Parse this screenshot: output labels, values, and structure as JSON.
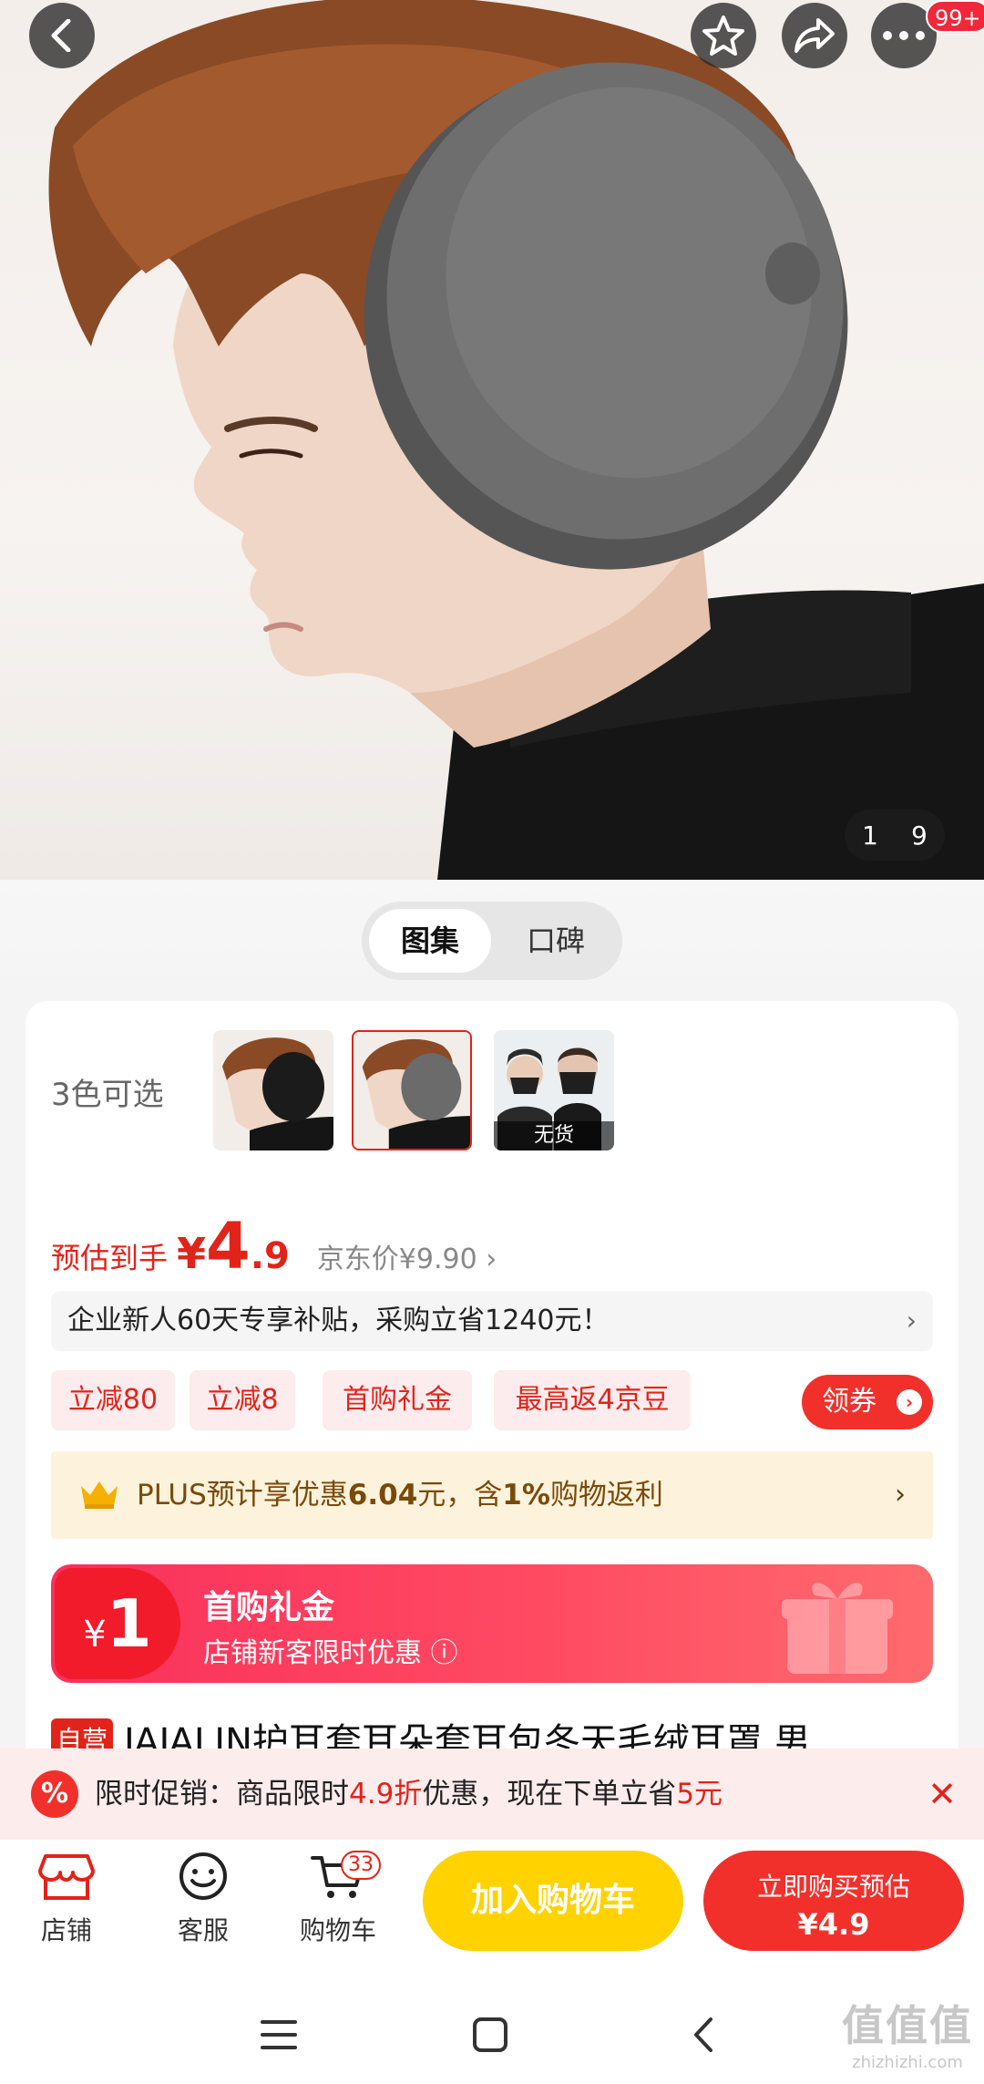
{
  "hero": {
    "counter_current": "1",
    "counter_total": "9",
    "badge": "99+"
  },
  "tabs": {
    "gallery": "图集",
    "reviews": "口碑"
  },
  "colors": {
    "label": "3色可选",
    "out_of_stock": "无货"
  },
  "price": {
    "label": "预估到手",
    "symbol": "¥",
    "integer": "4",
    "decimal": ".9",
    "jd_price": "京东价¥9.90 ›"
  },
  "promo_bar": {
    "text": "企业新人60天专享补贴，采购立省1240元！",
    "chevron": "›"
  },
  "tags": [
    "立减80",
    "立减8",
    "首购礼金",
    "最高返4京豆"
  ],
  "coupon": {
    "label": "领券",
    "arrow": "›"
  },
  "plus": {
    "prefix": "PLUS预计享优惠",
    "amount": "6.04",
    "mid": "元，含",
    "percent": "1%",
    "suffix": "购物返利",
    "chevron": "›"
  },
  "gift": {
    "symbol": "¥",
    "amount": "1",
    "title": "首购礼金",
    "subtitle": "店铺新客限时优惠 ⓘ"
  },
  "product": {
    "self_tag": "自营",
    "title": "JAJALIN护耳套耳朵套耳包冬天毛绒耳罩 男"
  },
  "flash": {
    "icon": "%",
    "prefix": "限时促销：商品限时",
    "discount": "4.9折",
    "mid": "优惠，现在下单立省",
    "save": "5元",
    "close": "✕"
  },
  "bottom": {
    "shop": "店铺",
    "service": "客服",
    "cart": "购物车",
    "cart_count": "33",
    "add_cart": "加入购物车",
    "buy_line1": "立即购买预估",
    "buy_line2": "¥4.9"
  },
  "watermark": {
    "main": "值值值",
    "sub": "zhizhizhi.com"
  },
  "theme": {
    "red": "#e2231a",
    "yellow": "#ffd200",
    "plus_bg": "#fdf3dc"
  }
}
